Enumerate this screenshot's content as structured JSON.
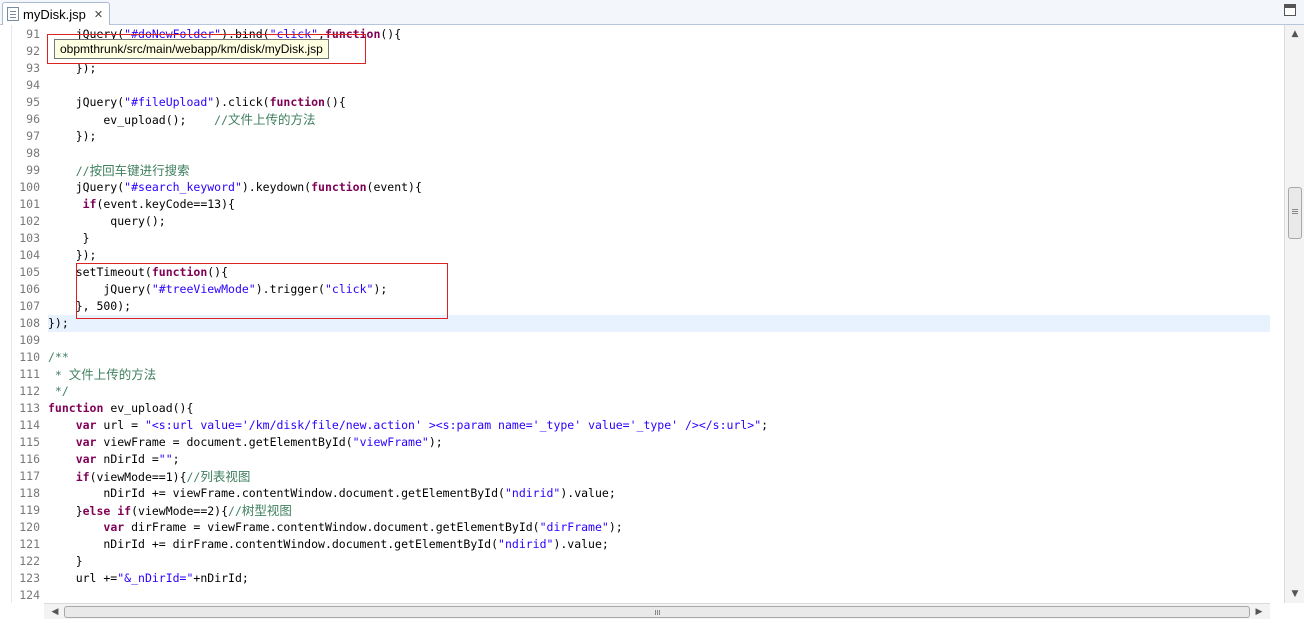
{
  "tab": {
    "filename": "myDisk.jsp",
    "close_glyph": "✕"
  },
  "tooltip": {
    "path": "obpmthrunk/src/main/webapp/km/disk/myDisk.jsp"
  },
  "colors": {
    "keyword": "#7f0055",
    "string": "#2a00ff",
    "comment": "#3f7f5f",
    "line_number": "#787878",
    "current_line": "#e8f2fe",
    "annotation": "#dd2222"
  },
  "icons": {
    "tab": "jsp-file-icon",
    "maximize": "maximize-icon",
    "scroll_up": "▲",
    "scroll_down": "▼",
    "scroll_left": "◀",
    "scroll_right": "▶"
  },
  "current_line_number": 108,
  "lines": [
    {
      "n": "91",
      "tokens": [
        [
          "",
          "    jQuery("
        ],
        [
          "s",
          "\"#doNewFolder\""
        ],
        [
          "",
          ").bind("
        ],
        [
          "s",
          "\"click\""
        ],
        [
          "",
          ","
        ],
        [
          "k",
          "function"
        ],
        [
          "",
          "(){"
        ]
      ]
    },
    {
      "n": "92",
      "tokens": [
        [
          "",
          ""
        ]
      ]
    },
    {
      "n": "93",
      "tokens": [
        [
          "",
          "    });"
        ]
      ]
    },
    {
      "n": "94",
      "tokens": [
        [
          "",
          ""
        ]
      ]
    },
    {
      "n": "95",
      "tokens": [
        [
          "",
          "    jQuery("
        ],
        [
          "s",
          "\"#fileUpload\""
        ],
        [
          "",
          ").click("
        ],
        [
          "k",
          "function"
        ],
        [
          "",
          "(){"
        ]
      ]
    },
    {
      "n": "96",
      "tokens": [
        [
          "",
          "        ev_upload();    "
        ],
        [
          "c",
          "//"
        ],
        [
          "czh",
          "文件上传的方法"
        ]
      ]
    },
    {
      "n": "97",
      "tokens": [
        [
          "",
          "    });"
        ]
      ]
    },
    {
      "n": "98",
      "tokens": [
        [
          "",
          ""
        ]
      ]
    },
    {
      "n": "99",
      "tokens": [
        [
          "",
          "    "
        ],
        [
          "c",
          "//"
        ],
        [
          "czh",
          "按回车键进行搜索"
        ]
      ]
    },
    {
      "n": "100",
      "tokens": [
        [
          "",
          "    jQuery("
        ],
        [
          "s",
          "\"#search_keyword\""
        ],
        [
          "",
          ").keydown("
        ],
        [
          "k",
          "function"
        ],
        [
          "",
          "(event){"
        ]
      ]
    },
    {
      "n": "101",
      "tokens": [
        [
          "",
          "     "
        ],
        [
          "k",
          "if"
        ],
        [
          "",
          "(event.keyCode==13){"
        ]
      ]
    },
    {
      "n": "102",
      "tokens": [
        [
          "",
          "         query();"
        ]
      ]
    },
    {
      "n": "103",
      "tokens": [
        [
          "",
          "     }"
        ]
      ]
    },
    {
      "n": "104",
      "tokens": [
        [
          "",
          "    });"
        ]
      ]
    },
    {
      "n": "105",
      "tokens": [
        [
          "",
          "    setTimeout("
        ],
        [
          "k",
          "function"
        ],
        [
          "",
          "(){"
        ]
      ]
    },
    {
      "n": "106",
      "tokens": [
        [
          "",
          "        jQuery("
        ],
        [
          "s",
          "\"#treeViewMode\""
        ],
        [
          "",
          ").trigger("
        ],
        [
          "s",
          "\"click\""
        ],
        [
          "",
          ");"
        ]
      ]
    },
    {
      "n": "107",
      "tokens": [
        [
          "",
          "    }, 500);"
        ]
      ]
    },
    {
      "n": "108",
      "tokens": [
        [
          "",
          "});"
        ]
      ]
    },
    {
      "n": "109",
      "tokens": [
        [
          "",
          ""
        ]
      ]
    },
    {
      "n": "110",
      "tokens": [
        [
          "c",
          "/**"
        ]
      ]
    },
    {
      "n": "111",
      "tokens": [
        [
          "c",
          " * "
        ],
        [
          "czh",
          "文件上传的方法"
        ]
      ]
    },
    {
      "n": "112",
      "tokens": [
        [
          "c",
          " */"
        ]
      ]
    },
    {
      "n": "113",
      "tokens": [
        [
          "k",
          "function"
        ],
        [
          "",
          " ev_upload(){"
        ]
      ]
    },
    {
      "n": "114",
      "tokens": [
        [
          "",
          "    "
        ],
        [
          "k",
          "var"
        ],
        [
          "",
          " url = "
        ],
        [
          "s",
          "\"<s:url value='/km/disk/file/new.action' ><s:param name='_type' value='_type' /></s:url>\""
        ],
        [
          "",
          ";"
        ]
      ]
    },
    {
      "n": "115",
      "tokens": [
        [
          "",
          "    "
        ],
        [
          "k",
          "var"
        ],
        [
          "",
          " viewFrame = document.getElementById("
        ],
        [
          "s",
          "\"viewFrame\""
        ],
        [
          "",
          ");"
        ]
      ]
    },
    {
      "n": "116",
      "tokens": [
        [
          "",
          "    "
        ],
        [
          "k",
          "var"
        ],
        [
          "",
          " nDirId ="
        ],
        [
          "s",
          "\"\""
        ],
        [
          "",
          ";"
        ]
      ]
    },
    {
      "n": "117",
      "tokens": [
        [
          "",
          "    "
        ],
        [
          "k",
          "if"
        ],
        [
          "",
          "(viewMode==1){"
        ],
        [
          "c",
          "//"
        ],
        [
          "czh",
          "列表视图"
        ]
      ]
    },
    {
      "n": "118",
      "tokens": [
        [
          "",
          "        nDirId += viewFrame.contentWindow.document.getElementById("
        ],
        [
          "s",
          "\"ndirid\""
        ],
        [
          "",
          ").value;"
        ]
      ]
    },
    {
      "n": "119",
      "tokens": [
        [
          "",
          "    }"
        ],
        [
          "k",
          "else if"
        ],
        [
          "",
          "(viewMode==2){"
        ],
        [
          "c",
          "//"
        ],
        [
          "czh",
          "树型视图"
        ]
      ]
    },
    {
      "n": "120",
      "tokens": [
        [
          "",
          "        "
        ],
        [
          "k",
          "var"
        ],
        [
          "",
          " dirFrame = viewFrame.contentWindow.document.getElementById("
        ],
        [
          "s",
          "\"dirFrame\""
        ],
        [
          "",
          ");"
        ]
      ]
    },
    {
      "n": "121",
      "tokens": [
        [
          "",
          "        nDirId += dirFrame.contentWindow.document.getElementById("
        ],
        [
          "s",
          "\"ndirid\""
        ],
        [
          "",
          ").value;"
        ]
      ]
    },
    {
      "n": "122",
      "tokens": [
        [
          "",
          "    }"
        ]
      ]
    },
    {
      "n": "123",
      "tokens": [
        [
          "",
          "    url +="
        ],
        [
          "s",
          "\"&_nDirId=\""
        ],
        [
          "",
          "+nDirId;"
        ]
      ]
    },
    {
      "n": "124",
      "tokens": [
        [
          "",
          ""
        ]
      ]
    }
  ]
}
